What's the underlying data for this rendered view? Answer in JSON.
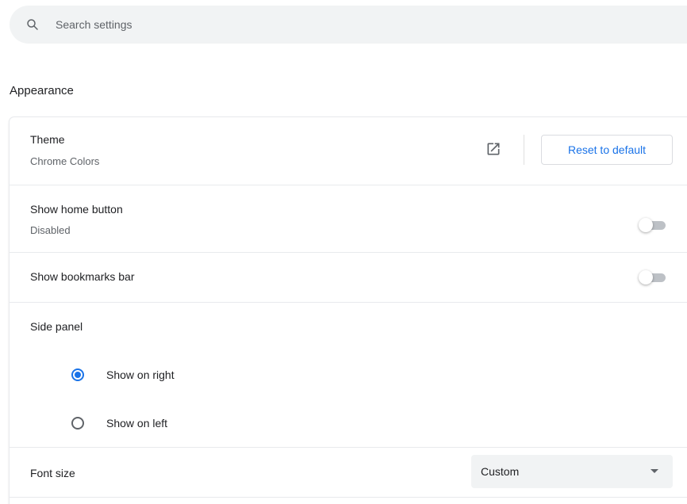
{
  "search": {
    "placeholder": "Search settings",
    "value": ""
  },
  "appearance": {
    "title": "Appearance",
    "theme": {
      "label": "Theme",
      "value": "Chrome Colors",
      "reset_label": "Reset to default",
      "icon": "open-in-new-icon"
    },
    "home_button": {
      "label": "Show home button",
      "status": "Disabled",
      "enabled": false
    },
    "bookmarks_bar": {
      "label": "Show bookmarks bar",
      "enabled": false
    },
    "side_panel": {
      "label": "Side panel",
      "options": [
        {
          "label": "Show on right",
          "selected": true
        },
        {
          "label": "Show on left",
          "selected": false
        }
      ]
    },
    "font_size": {
      "label": "Font size",
      "selected": "Custom"
    }
  },
  "colors": {
    "accent": "#1a73e8",
    "search_bg": "#f1f3f4",
    "toggle_off_track": "#bdc1c6"
  }
}
